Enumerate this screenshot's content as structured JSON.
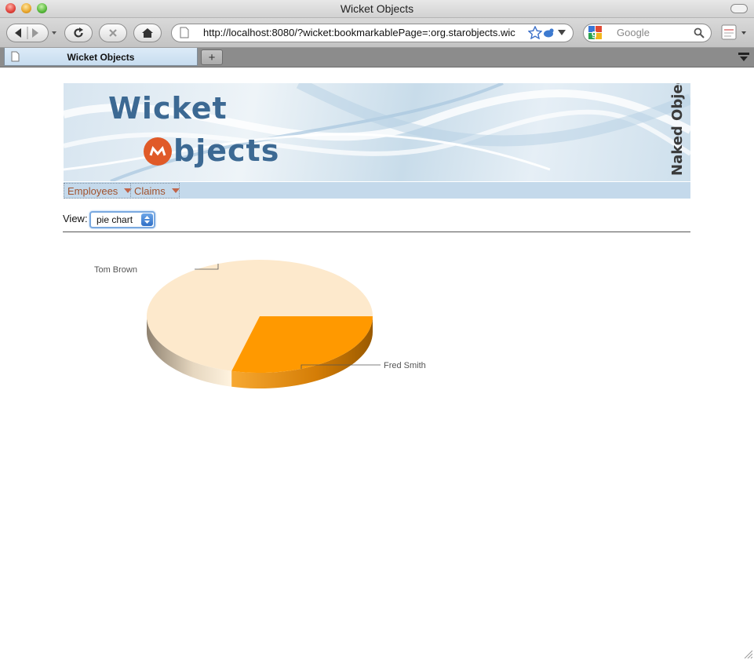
{
  "window": {
    "title": "Wicket Objects"
  },
  "toolbar": {
    "url": "http://localhost:8080/?wicket:bookmarkablePage=:org.starobjects.wic",
    "search_placeholder": "Google"
  },
  "tabs": [
    {
      "label": "Wicket Objects"
    }
  ],
  "banner": {
    "logo_line1": "Wicket",
    "logo_line2": "bjects",
    "side_text": "Naked Objects"
  },
  "menu": [
    {
      "label": "Employees"
    },
    {
      "label": "Claims"
    }
  ],
  "view": {
    "label": "View:",
    "selected": "pie chart"
  },
  "chart_data": {
    "type": "pie",
    "categories": [
      "Tom Brown",
      "Fred Smith"
    ],
    "values": [
      71,
      29
    ],
    "colors": {
      "Tom Brown": "#fde9cc",
      "Fred Smith": "#ff9900"
    },
    "title": ""
  }
}
